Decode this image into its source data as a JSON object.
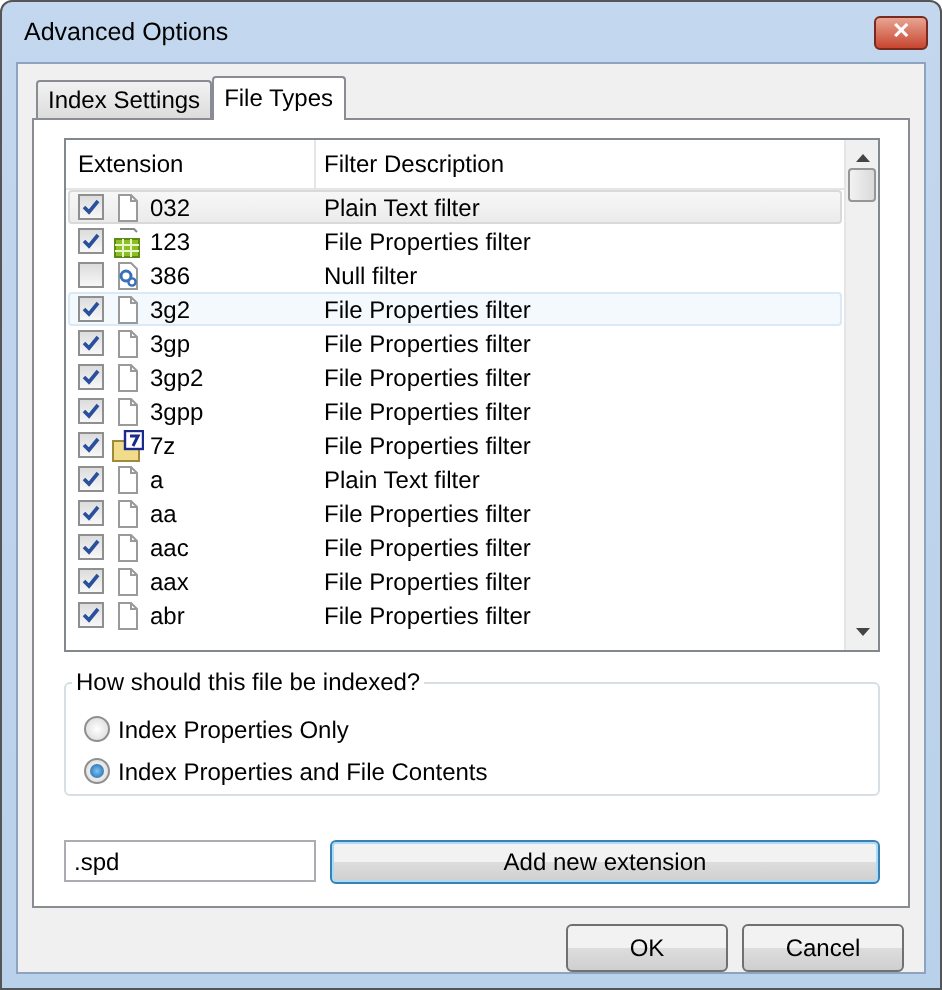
{
  "window": {
    "title": "Advanced Options",
    "close": "✕"
  },
  "tabs": [
    {
      "label": "Index Settings",
      "selected": false
    },
    {
      "label": "File Types",
      "selected": true
    }
  ],
  "table": {
    "columns": [
      "Extension",
      "Filter Description"
    ],
    "rows": [
      {
        "checked": true,
        "kind": "file",
        "extension": "032",
        "filter": "Plain Text filter",
        "selected": true,
        "hovered": false
      },
      {
        "checked": true,
        "kind": "spreadsheet",
        "extension": "123",
        "filter": "File Properties filter",
        "selected": false,
        "hovered": false
      },
      {
        "checked": false,
        "kind": "gear",
        "extension": "386",
        "filter": "Null filter",
        "selected": false,
        "hovered": false
      },
      {
        "checked": true,
        "kind": "file",
        "extension": "3g2",
        "filter": "File Properties filter",
        "selected": false,
        "hovered": true
      },
      {
        "checked": true,
        "kind": "file",
        "extension": "3gp",
        "filter": "File Properties filter",
        "selected": false,
        "hovered": false
      },
      {
        "checked": true,
        "kind": "file",
        "extension": "3gp2",
        "filter": "File Properties filter",
        "selected": false,
        "hovered": false
      },
      {
        "checked": true,
        "kind": "file",
        "extension": "3gpp",
        "filter": "File Properties filter",
        "selected": false,
        "hovered": false
      },
      {
        "checked": true,
        "kind": "archive",
        "extension": "7z",
        "filter": "File Properties filter",
        "selected": false,
        "hovered": false
      },
      {
        "checked": true,
        "kind": "file",
        "extension": "a",
        "filter": "Plain Text filter",
        "selected": false,
        "hovered": false
      },
      {
        "checked": true,
        "kind": "file",
        "extension": "aa",
        "filter": "File Properties filter",
        "selected": false,
        "hovered": false
      },
      {
        "checked": true,
        "kind": "file",
        "extension": "aac",
        "filter": "File Properties filter",
        "selected": false,
        "hovered": false
      },
      {
        "checked": true,
        "kind": "file",
        "extension": "aax",
        "filter": "File Properties filter",
        "selected": false,
        "hovered": false
      },
      {
        "checked": true,
        "kind": "file",
        "extension": "abr",
        "filter": "File Properties filter",
        "selected": false,
        "hovered": false
      }
    ]
  },
  "index_group": {
    "legend": "How should this file be indexed?",
    "options": [
      {
        "label": "Index Properties Only",
        "selected": false
      },
      {
        "label": "Index Properties and File Contents",
        "selected": true
      }
    ]
  },
  "new_extension": {
    "value": ".spd",
    "button": "Add new extension"
  },
  "buttons": [
    "OK",
    "Cancel"
  ]
}
